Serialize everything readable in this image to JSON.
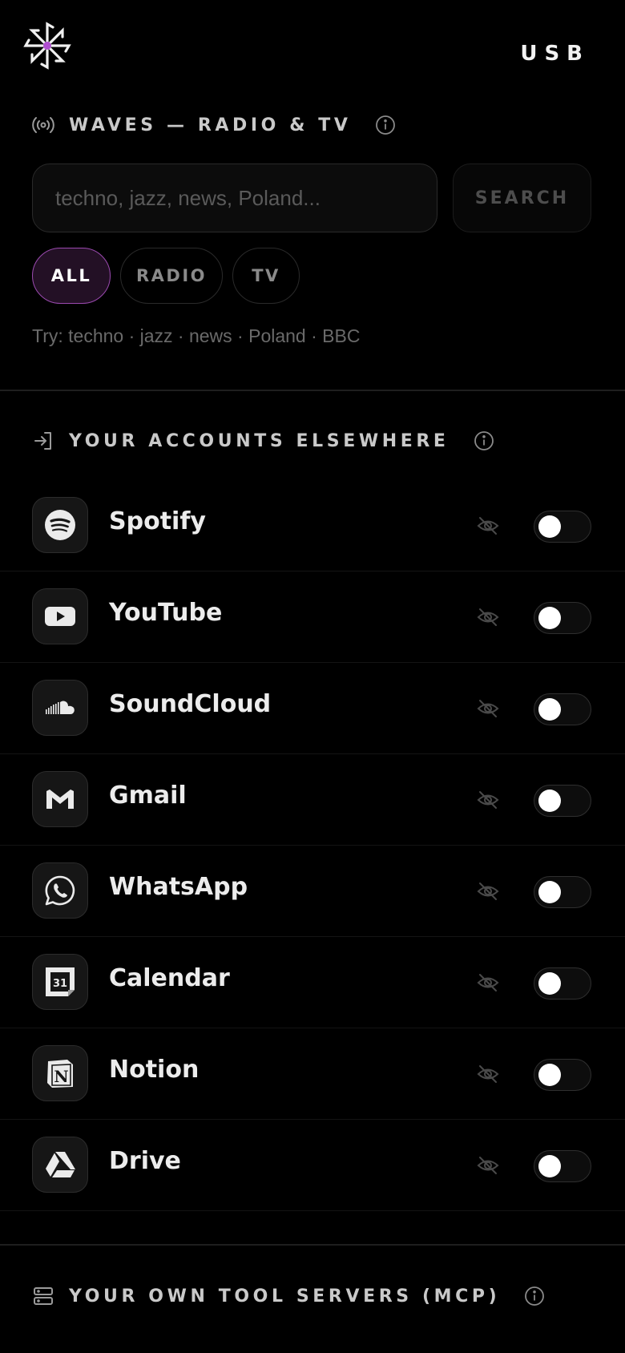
{
  "header": {
    "badge": "USB"
  },
  "waves": {
    "title": "WAVES — RADIO & TV",
    "search_placeholder": "techno, jazz, news, Poland...",
    "search_label": "SEARCH",
    "filters": [
      "ALL",
      "RADIO",
      "TV"
    ],
    "active_filter": "ALL",
    "hint": "Try: techno · jazz · news · Poland · BBC"
  },
  "accounts": {
    "title": "YOUR ACCOUNTS ELSEWHERE",
    "items": [
      {
        "name": "Spotify",
        "icon": "spotify-icon",
        "visible": false,
        "enabled": false
      },
      {
        "name": "YouTube",
        "icon": "youtube-icon",
        "visible": false,
        "enabled": false
      },
      {
        "name": "SoundCloud",
        "icon": "soundcloud-icon",
        "visible": false,
        "enabled": false
      },
      {
        "name": "Gmail",
        "icon": "gmail-icon",
        "visible": false,
        "enabled": false
      },
      {
        "name": "WhatsApp",
        "icon": "whatsapp-icon",
        "visible": false,
        "enabled": false
      },
      {
        "name": "Calendar",
        "icon": "calendar-icon",
        "visible": false,
        "enabled": false
      },
      {
        "name": "Notion",
        "icon": "notion-icon",
        "visible": false,
        "enabled": false
      },
      {
        "name": "Drive",
        "icon": "drive-icon",
        "visible": false,
        "enabled": false
      }
    ],
    "calendar_day": "31",
    "notion_letter": "N"
  },
  "mcp": {
    "title": "YOUR OWN TOOL SERVERS (MCP)"
  },
  "colors": {
    "accent": "#9b4ab0",
    "background": "#000000"
  }
}
